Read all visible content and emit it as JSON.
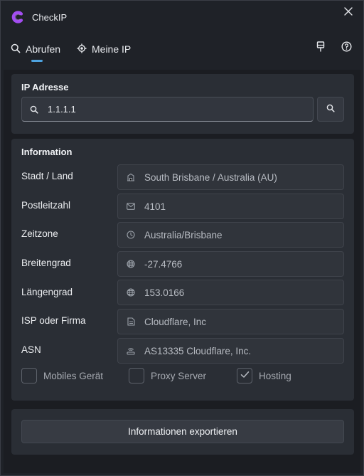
{
  "app": {
    "title": "CheckIP"
  },
  "tabs": [
    {
      "label": "Abrufen",
      "icon": "search-icon",
      "active": true
    },
    {
      "label": "Meine IP",
      "icon": "location-target-icon",
      "active": false
    }
  ],
  "ip_section": {
    "heading": "IP Adresse",
    "value": "1.1.1.1"
  },
  "info_section": {
    "heading": "Information",
    "rows": [
      {
        "label": "Stadt / Land",
        "icon": "building-icon",
        "value": "South Brisbane / Australia (AU)"
      },
      {
        "label": "Postleitzahl",
        "icon": "mail-icon",
        "value": "4101"
      },
      {
        "label": "Zeitzone",
        "icon": "clock-icon",
        "value": "Australia/Brisbane"
      },
      {
        "label": "Breitengrad",
        "icon": "globe-icon",
        "value": "-27.4766"
      },
      {
        "label": "Längengrad",
        "icon": "globe-icon",
        "value": "153.0166"
      },
      {
        "label": "ISP oder Firma",
        "icon": "document-icon",
        "value": "Cloudflare, Inc"
      },
      {
        "label": "ASN",
        "icon": "router-icon",
        "value": "AS13335 Cloudflare, Inc."
      }
    ],
    "checks": [
      {
        "label": "Mobiles Gerät",
        "checked": false
      },
      {
        "label": "Proxy Server",
        "checked": false
      },
      {
        "label": "Hosting",
        "checked": true
      }
    ]
  },
  "export": {
    "label": "Informationen exportieren"
  },
  "colors": {
    "accent": "#4ea3e0",
    "logo": "#a34df2",
    "background": "#1f2228",
    "panel": "#2a2e35"
  }
}
